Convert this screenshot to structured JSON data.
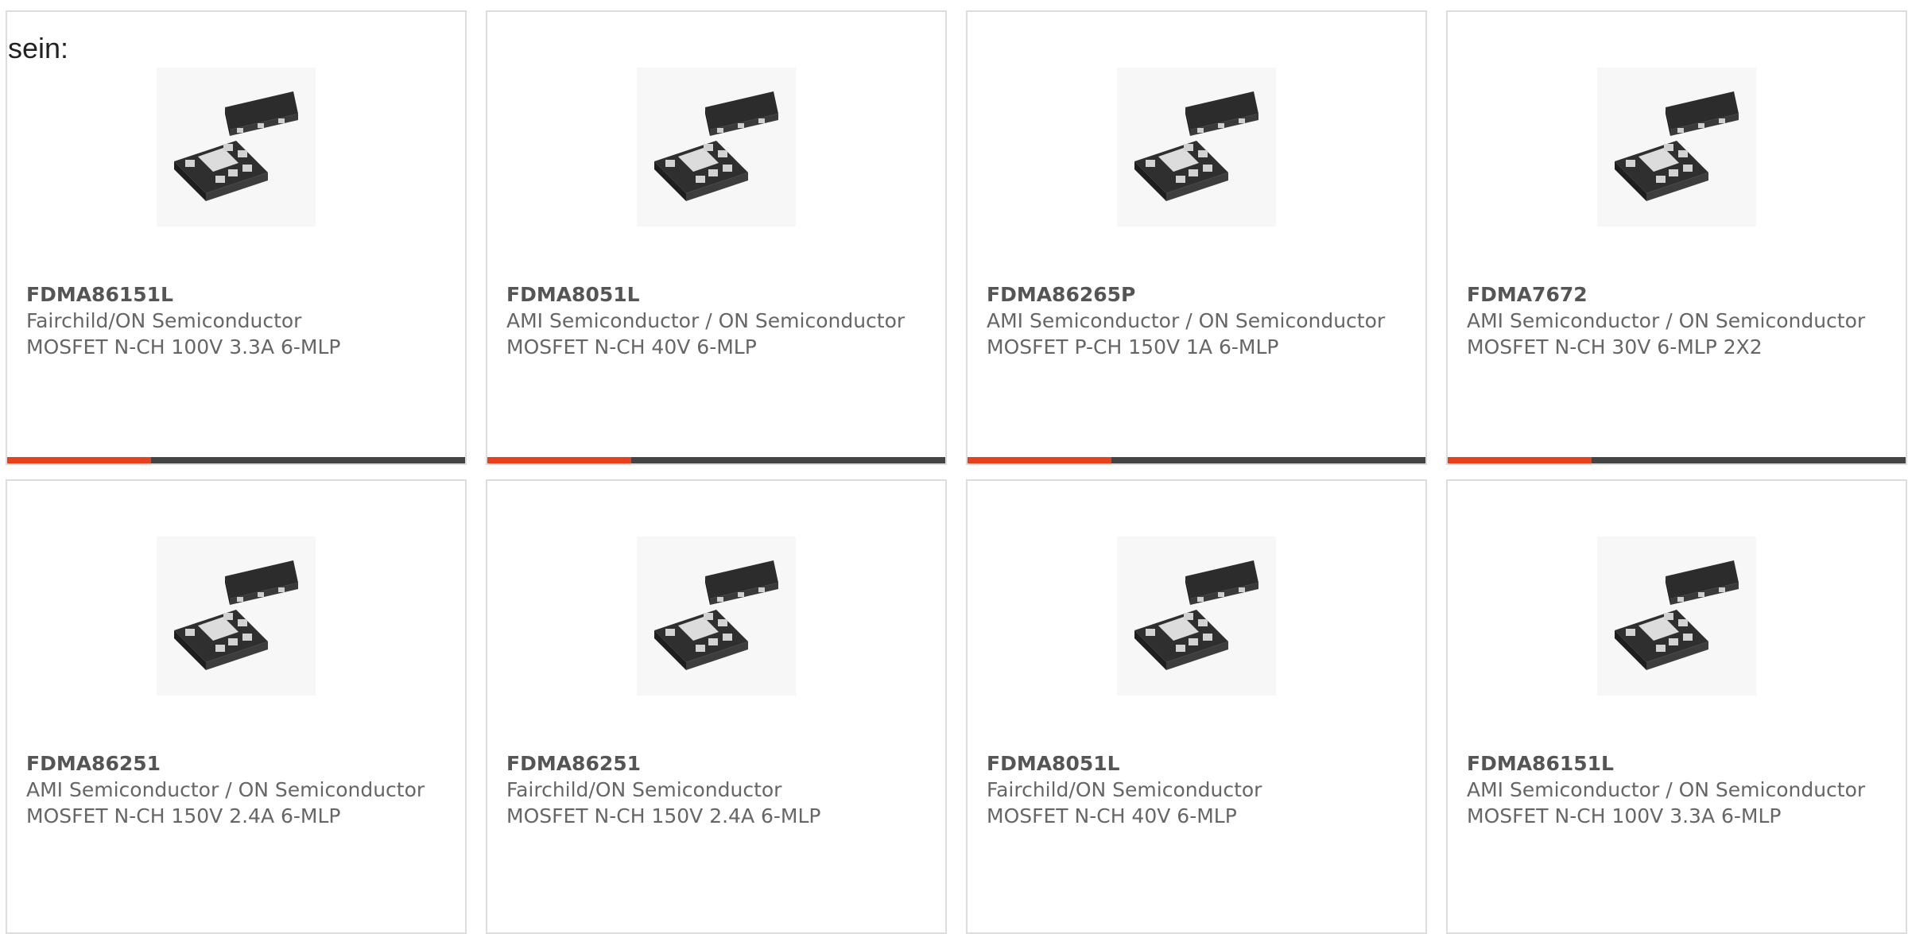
{
  "intro_text": "sein:",
  "colors": {
    "accent": "#e8401c",
    "bar": "#444444",
    "border": "#dddddd",
    "text": "#666666"
  },
  "products": [
    {
      "part": "FDMA86151L",
      "manufacturer": "Fairchild/ON Semiconductor",
      "description": "MOSFET N-CH 100V 3.3A 6-MLP",
      "image_icon": "mlp6-package-icon",
      "hover_bar": true
    },
    {
      "part": "FDMA8051L",
      "manufacturer": "AMI Semiconductor / ON Semiconductor",
      "description": "MOSFET N-CH 40V 6-MLP",
      "image_icon": "mlp6-package-icon",
      "hover_bar": true
    },
    {
      "part": "FDMA86265P",
      "manufacturer": "AMI Semiconductor / ON Semiconductor",
      "description": "MOSFET P-CH 150V 1A 6-MLP",
      "image_icon": "mlp6-package-icon",
      "hover_bar": true
    },
    {
      "part": "FDMA7672",
      "manufacturer": "AMI Semiconductor / ON Semiconductor",
      "description": "MOSFET N-CH 30V 6-MLP 2X2",
      "image_icon": "mlp6-package-icon",
      "hover_bar": true
    },
    {
      "part": "FDMA86251",
      "manufacturer": "AMI Semiconductor / ON Semiconductor",
      "description": "MOSFET N-CH 150V 2.4A 6-MLP",
      "image_icon": "mlp6-package-icon",
      "hover_bar": false
    },
    {
      "part": "FDMA86251",
      "manufacturer": "Fairchild/ON Semiconductor",
      "description": "MOSFET N-CH 150V 2.4A 6-MLP",
      "image_icon": "mlp6-package-icon",
      "hover_bar": false
    },
    {
      "part": "FDMA8051L",
      "manufacturer": "Fairchild/ON Semiconductor",
      "description": "MOSFET N-CH 40V 6-MLP",
      "image_icon": "mlp6-package-icon",
      "hover_bar": false
    },
    {
      "part": "FDMA86151L",
      "manufacturer": "AMI Semiconductor / ON Semiconductor",
      "description": "MOSFET N-CH 100V 3.3A 6-MLP",
      "image_icon": "mlp6-package-icon",
      "hover_bar": false
    }
  ]
}
